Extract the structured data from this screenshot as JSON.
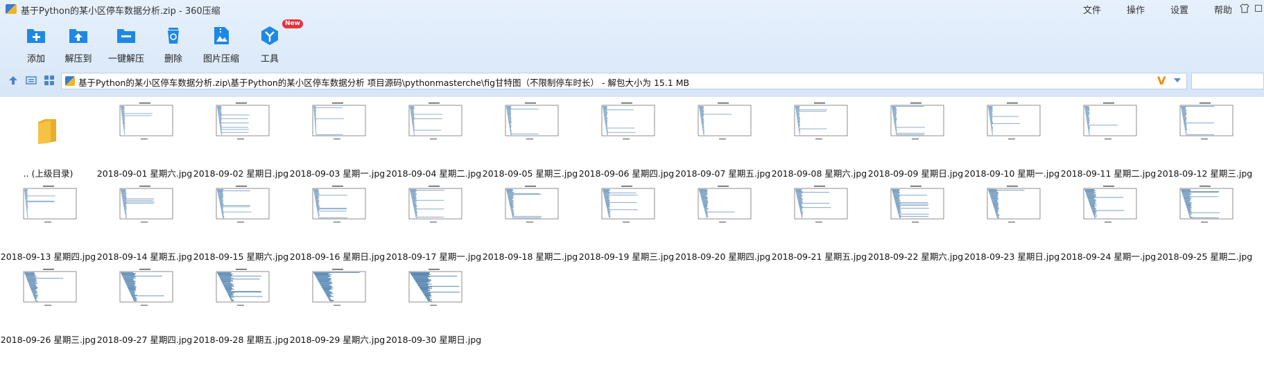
{
  "window": {
    "title": "基于Python的某小区停车数据分析.zip - 360压缩",
    "menus": [
      "文件",
      "操作",
      "设置",
      "帮助"
    ]
  },
  "toolbar": {
    "buttons": [
      {
        "label": "添加",
        "icon": "add-icon"
      },
      {
        "label": "解压到",
        "icon": "extract-to-icon"
      },
      {
        "label": "一键解压",
        "icon": "one-click-extract-icon"
      },
      {
        "label": "删除",
        "icon": "delete-icon"
      },
      {
        "label": "图片压缩",
        "icon": "image-compress-icon"
      },
      {
        "label": "工具",
        "icon": "tools-icon",
        "badge": "New"
      }
    ]
  },
  "address": {
    "path": "基于Python的某小区停车数据分析.zip\\基于Python的某小区停车数据分析 项目源码\\pythonmasterche\\fig甘特图（不限制停车时长） - 解包大小为 15.1 MB"
  },
  "colors": {
    "accent": "#1e88e5",
    "chart_fill": "#1f5f99",
    "folder": "#f5c242",
    "badge": "#e8323c"
  },
  "files": [
    {
      "name": ".. (上级目录)",
      "type": "parent-folder"
    },
    {
      "name": "2018-09-01 星期六.jpg",
      "type": "jpg",
      "density": 0.18
    },
    {
      "name": "2018-09-02 星期日.jpg",
      "type": "jpg",
      "density": 0.2
    },
    {
      "name": "2018-09-03 星期一.jpg",
      "type": "jpg",
      "density": 0.12
    },
    {
      "name": "2018-09-04 星期二.jpg",
      "type": "jpg",
      "density": 0.2
    },
    {
      "name": "2018-09-05 星期三.jpg",
      "type": "jpg",
      "density": 0.22
    },
    {
      "name": "2018-09-06 星期四.jpg",
      "type": "jpg",
      "density": 0.22
    },
    {
      "name": "2018-09-07 星期五.jpg",
      "type": "jpg",
      "density": 0.22
    },
    {
      "name": "2018-09-08 星期六.jpg",
      "type": "jpg",
      "density": 0.2
    },
    {
      "name": "2018-09-09 星期日.jpg",
      "type": "jpg",
      "density": 0.22
    },
    {
      "name": "2018-09-10 星期一.jpg",
      "type": "jpg",
      "density": 0.2
    },
    {
      "name": "2018-09-11 星期二.jpg",
      "type": "jpg",
      "density": 0.22
    },
    {
      "name": "2018-09-12 星期三.jpg",
      "type": "jpg",
      "density": 0.25
    },
    {
      "name": "2018-09-13 星期四.jpg",
      "type": "jpg",
      "density": 0.15
    },
    {
      "name": "2018-09-14 星期五.jpg",
      "type": "jpg",
      "density": 0.25
    },
    {
      "name": "2018-09-15 星期六.jpg",
      "type": "jpg",
      "density": 0.28
    },
    {
      "name": "2018-09-16 星期日.jpg",
      "type": "jpg",
      "density": 0.25
    },
    {
      "name": "2018-09-17 星期一.jpg",
      "type": "jpg",
      "density": 0.3
    },
    {
      "name": "2018-09-18 星期二.jpg",
      "type": "jpg",
      "density": 0.32
    },
    {
      "name": "2018-09-19 星期三.jpg",
      "type": "jpg",
      "density": 0.32
    },
    {
      "name": "2018-09-20 星期四.jpg",
      "type": "jpg",
      "density": 0.38
    },
    {
      "name": "2018-09-21 星期五.jpg",
      "type": "jpg",
      "density": 0.32
    },
    {
      "name": "2018-09-22 星期六.jpg",
      "type": "jpg",
      "density": 0.38
    },
    {
      "name": "2018-09-23 星期日.jpg",
      "type": "jpg",
      "density": 0.45
    },
    {
      "name": "2018-09-24 星期一.jpg",
      "type": "jpg",
      "density": 0.5
    },
    {
      "name": "2018-09-25 星期二.jpg",
      "type": "jpg",
      "density": 0.45
    },
    {
      "name": "2018-09-26 星期三.jpg",
      "type": "jpg",
      "density": 0.55
    },
    {
      "name": "2018-09-27 星期四.jpg",
      "type": "jpg",
      "density": 0.65
    },
    {
      "name": "2018-09-28 星期五.jpg",
      "type": "jpg",
      "density": 0.7
    },
    {
      "name": "2018-09-29 星期六.jpg",
      "type": "jpg",
      "density": 0.8
    },
    {
      "name": "2018-09-30 星期日.jpg",
      "type": "jpg",
      "density": 0.9
    }
  ]
}
